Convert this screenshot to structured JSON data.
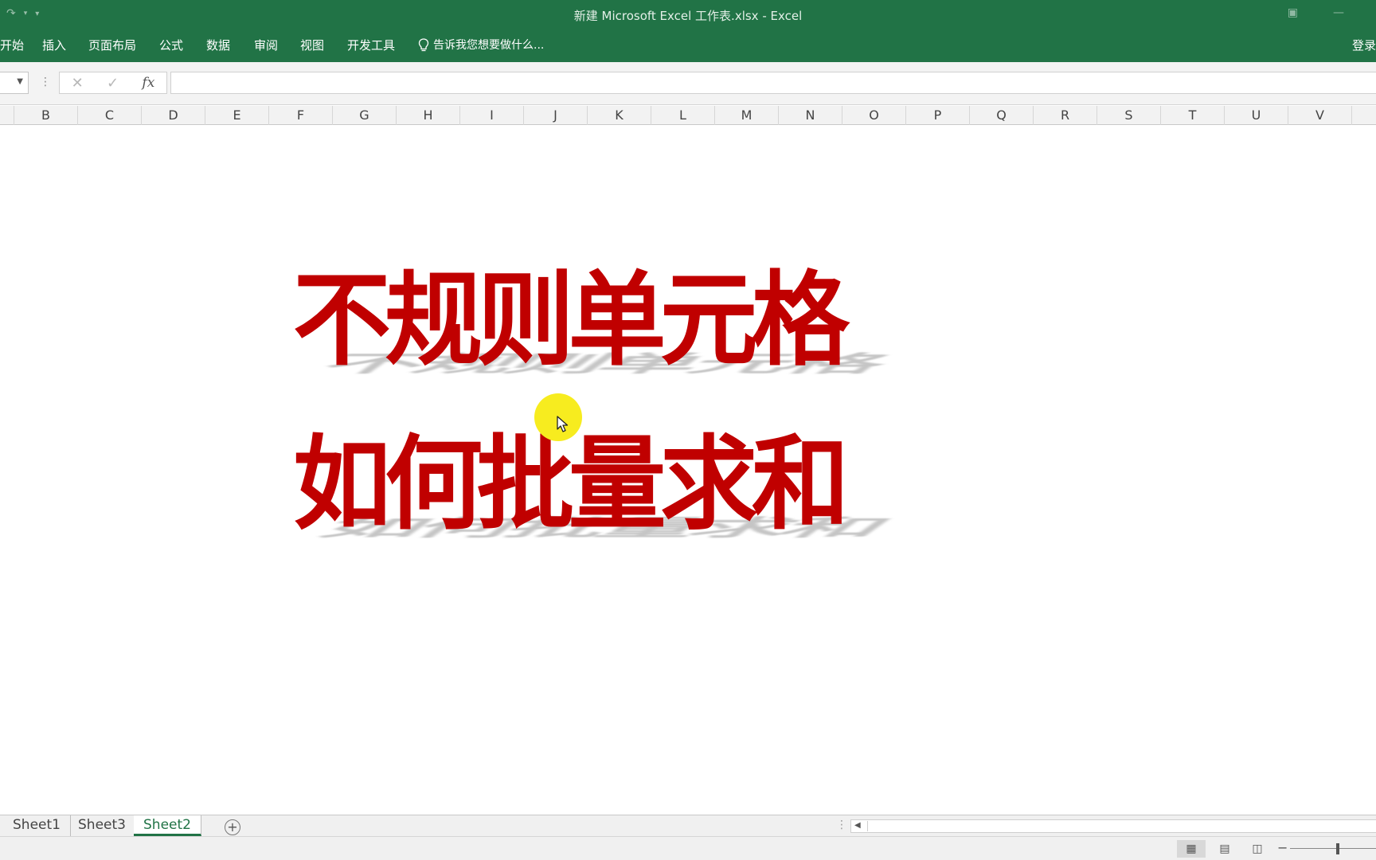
{
  "window": {
    "title": "新建 Microsoft Excel 工作表.xlsx - Excel"
  },
  "ribbon": {
    "tabs": [
      "开始",
      "插入",
      "页面布局",
      "公式",
      "数据",
      "审阅",
      "视图",
      "开发工具"
    ],
    "tell_me": "告诉我您想要做什么...",
    "sign_in": "登录"
  },
  "formula_bar": {
    "fx_label": "fx",
    "value": ""
  },
  "columns": [
    "B",
    "C",
    "D",
    "E",
    "F",
    "G",
    "H",
    "I",
    "J",
    "K",
    "L",
    "M",
    "N",
    "O",
    "P",
    "Q",
    "R",
    "S",
    "T",
    "U",
    "V"
  ],
  "content": {
    "headline_line1": "不规则单元格",
    "headline_line2": "如何批量求和",
    "headline_color": "#c00000"
  },
  "sheets": {
    "tabs": [
      "Sheet1",
      "Sheet3",
      "Sheet2"
    ],
    "active": "Sheet2"
  },
  "colors": {
    "excel_green": "#217346",
    "cursor_highlight": "#f7ec1f"
  }
}
